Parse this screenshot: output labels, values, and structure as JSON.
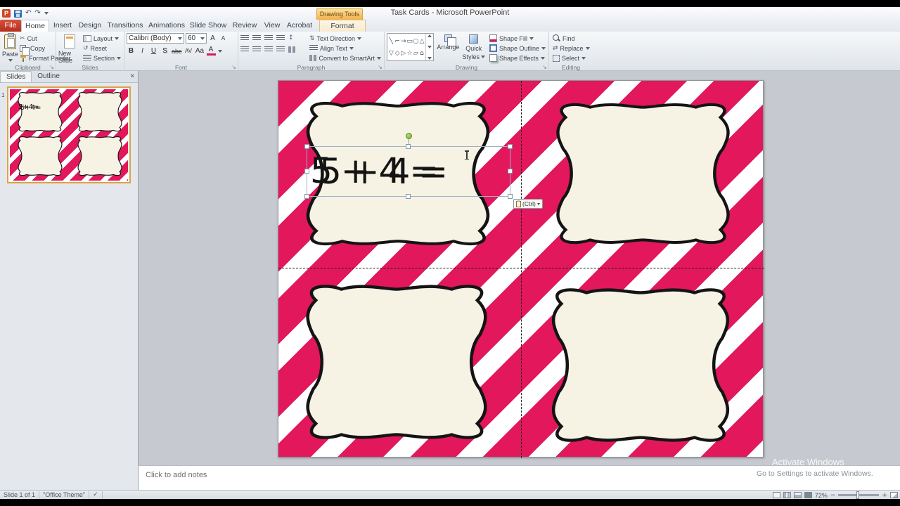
{
  "window": {
    "title": "Task Cards  -  Microsoft PowerPoint"
  },
  "context": {
    "chip": "Drawing Tools",
    "tab": "Format"
  },
  "tabs": [
    "File",
    "Home",
    "Insert",
    "Design",
    "Transitions",
    "Animations",
    "Slide Show",
    "Review",
    "View",
    "Acrobat"
  ],
  "icons": {
    "ppt_logo": "P",
    "undo": "↶",
    "redo": "↷",
    "scissors": "✂",
    "reset_arrow": "↺",
    "launcher": "↘",
    "letter_a": "A",
    "text_direction": "⇅",
    "line_spacing": "↕",
    "swap": "⇄",
    "check": "✓",
    "minus": "−",
    "plus": "+",
    "close": "✕"
  },
  "ribbon": {
    "clipboard": {
      "label": "Clipboard",
      "paste": "Paste",
      "cut": "Cut",
      "copy": "Copy",
      "format_painter": "Format Painter"
    },
    "slides": {
      "label": "Slides",
      "new_slide": "New Slide",
      "layout": "Layout",
      "reset": "Reset",
      "section": "Section"
    },
    "font": {
      "label": "Font",
      "font_name": "Calibri (Body)",
      "font_size": "60",
      "bold": "B",
      "italic": "I",
      "underline": "U",
      "shadow": "S",
      "strike": "abc",
      "spacing": "AV",
      "case_btn": "Aa",
      "color_btn": "A"
    },
    "paragraph": {
      "label": "Paragraph",
      "text_direction": "Text Direction",
      "align_text": "Align Text",
      "smartart": "Convert to SmartArt"
    },
    "drawing": {
      "label": "Drawing",
      "arrange": "Arrange",
      "quick_styles_1": "Quick",
      "quick_styles_2": "Styles",
      "shape_fill": "Shape Fill",
      "shape_outline": "Shape Outline",
      "shape_effects": "Shape Effects",
      "shapes": [
        "╲",
        "⌐",
        "→",
        "▭",
        "○",
        "△",
        "▽",
        "◇",
        "▷",
        "☆",
        "▱",
        "⌂"
      ]
    },
    "editing": {
      "label": "Editing",
      "find": "Find",
      "replace": "Replace",
      "select": "Select"
    }
  },
  "pane": {
    "tab_slides": "Slides",
    "tab_outline": "Outline",
    "slide_number": "1"
  },
  "thumb": {
    "text": "5+4=",
    "text_ghost": "5+4="
  },
  "canvas": {
    "expression": "5 + 4 =",
    "expression_ghost": "5 + 4 =",
    "paste_hint": "(Ctrl)"
  },
  "notes": {
    "placeholder": "Click to add notes"
  },
  "status": {
    "slide_indicator": "Slide 1 of 1",
    "theme": "\"Office Theme\"",
    "zoom": "72%"
  },
  "watermark": {
    "line1": "Activate Windows",
    "line2": "Go to Settings to activate Windows."
  },
  "colors": {
    "stripe_pink": "#e2175c",
    "card_cream": "#f6f2e4",
    "contextual_orange": "#f2b14b",
    "file_tab_red": "#b52f1e"
  }
}
